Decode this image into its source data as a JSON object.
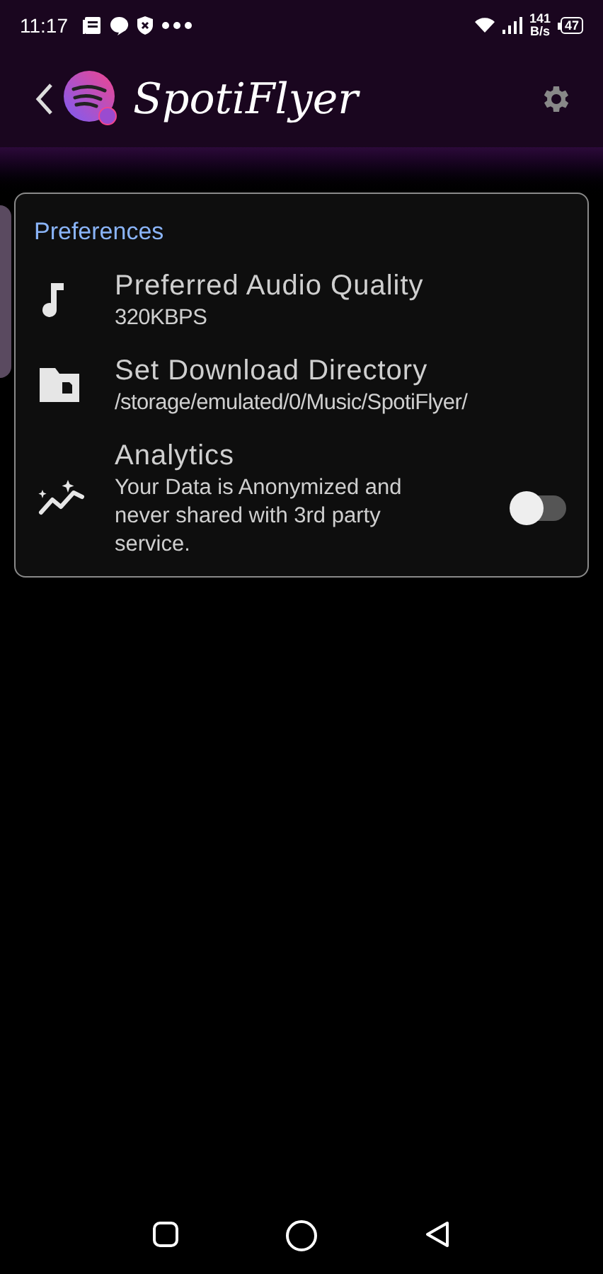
{
  "status_bar": {
    "time": "11:17",
    "net_speed": "141",
    "net_unit": "B/s",
    "battery": "47"
  },
  "app_bar": {
    "title": "SpotiFlyer"
  },
  "preferences": {
    "title": "Preferences",
    "items": [
      {
        "kind": "value",
        "title": "Preferred Audio Quality",
        "subtitle": "320KBPS"
      },
      {
        "kind": "value",
        "title": "Set Download Directory",
        "subtitle": "/storage/emulated/0/Music/SpotiFlyer/"
      },
      {
        "kind": "switch",
        "title": "Analytics",
        "subtitle": "Your Data is Anonymized and never shared with 3rd party service.",
        "on": false
      }
    ]
  }
}
